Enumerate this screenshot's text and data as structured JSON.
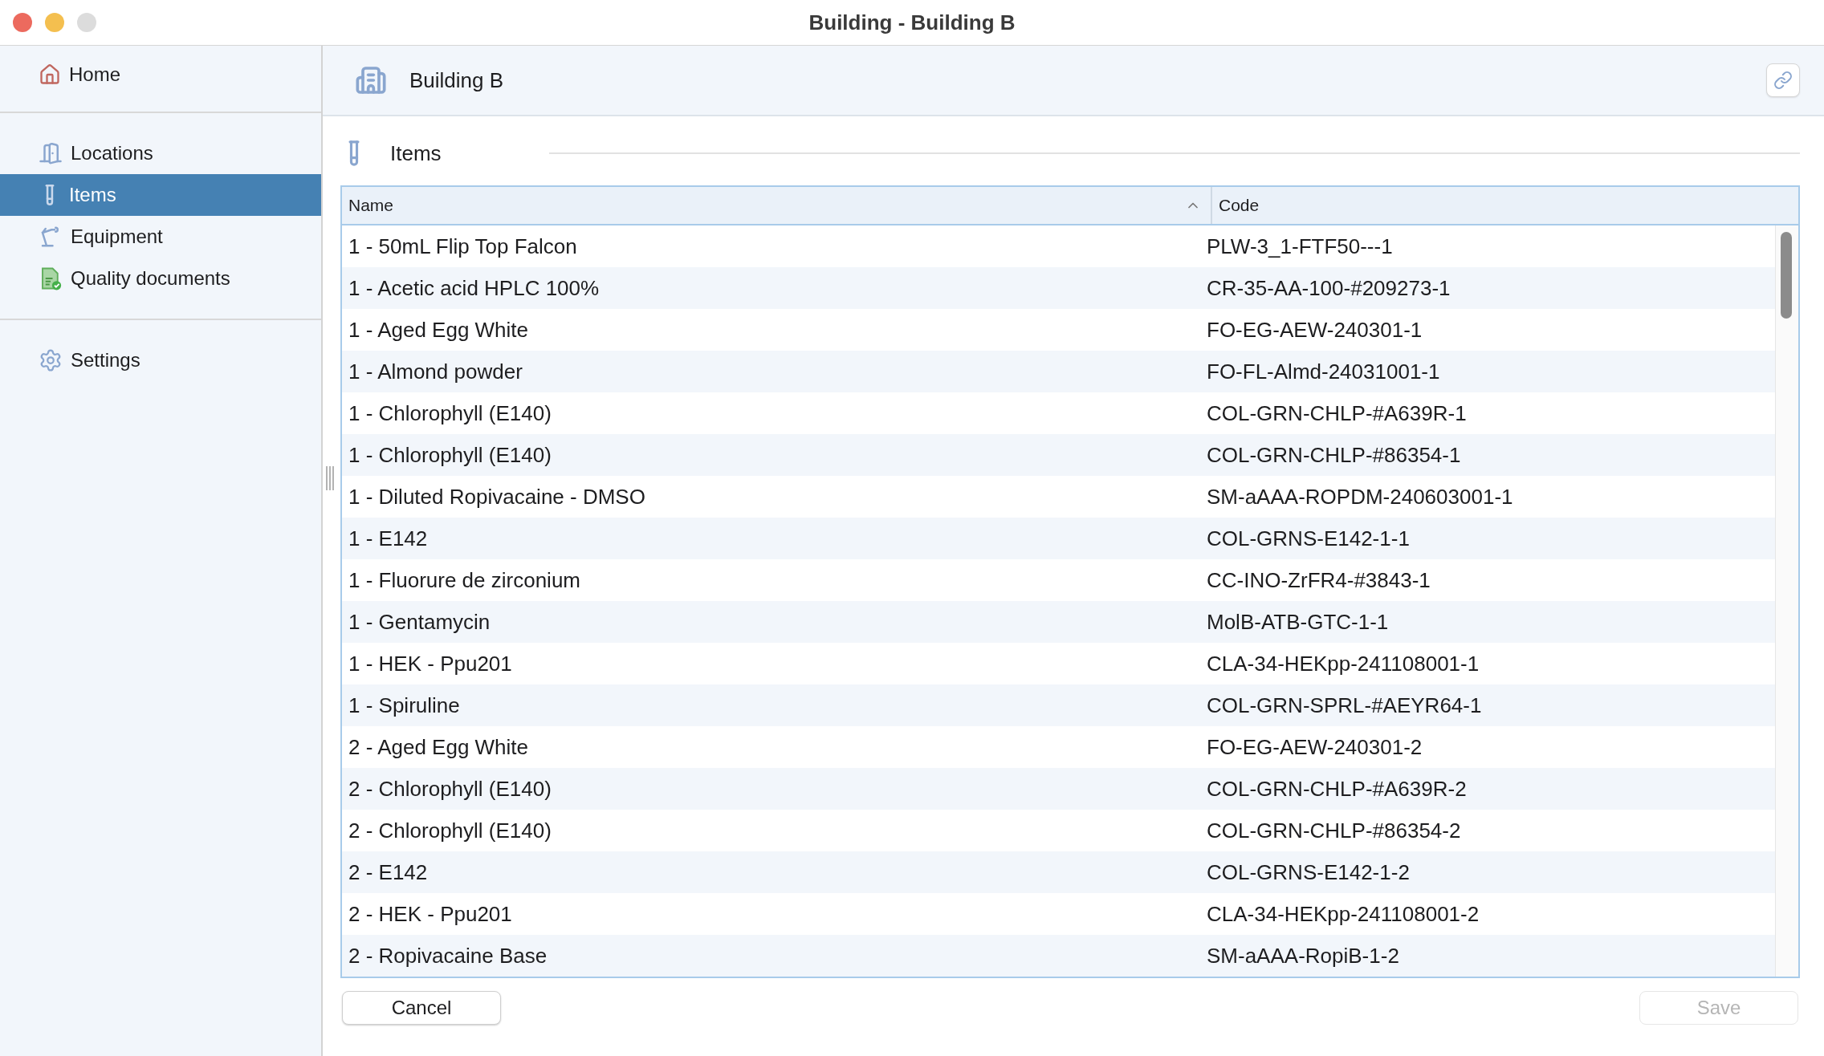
{
  "window": {
    "title": "Building - Building B"
  },
  "sidebar": {
    "sections": [
      [
        {
          "label": "Home",
          "selected": false
        }
      ],
      [
        {
          "label": "Locations",
          "selected": false
        },
        {
          "label": "Items",
          "selected": true
        },
        {
          "label": "Equipment",
          "selected": false
        },
        {
          "label": "Quality documents",
          "selected": false
        }
      ],
      [
        {
          "label": "Settings",
          "selected": false
        }
      ]
    ]
  },
  "header": {
    "title": "Building B"
  },
  "section": {
    "title": "Items"
  },
  "table": {
    "columns": [
      {
        "label": "Name",
        "sorted": true
      },
      {
        "label": "Code",
        "sorted": false
      }
    ],
    "rows": [
      [
        "1 - 50mL Flip Top Falcon",
        "PLW-3_1-FTF50---1"
      ],
      [
        "1 - Acetic acid HPLC 100%",
        "CR-35-AA-100-#209273-1"
      ],
      [
        "1 - Aged Egg White",
        "FO-EG-AEW-240301-1"
      ],
      [
        "1 - Almond powder",
        "FO-FL-Almd-24031001-1"
      ],
      [
        "1 - Chlorophyll (E140)",
        "COL-GRN-CHLP-#A639R-1"
      ],
      [
        "1 - Chlorophyll (E140)",
        "COL-GRN-CHLP-#86354-1"
      ],
      [
        "1 - Diluted Ropivacaine - DMSO",
        "SM-aAAA-ROPDM-240603001-1"
      ],
      [
        "1 - E142",
        "COL-GRNS-E142-1-1"
      ],
      [
        "1 - Fluorure de zirconium",
        "CC-INO-ZrFR4-#3843-1"
      ],
      [
        "1 - Gentamycin",
        "MolB-ATB-GTC-1-1"
      ],
      [
        "1 - HEK - Ppu201",
        "CLA-34-HEKpp-241108001-1"
      ],
      [
        "1 - Spiruline",
        "COL-GRN-SPRL-#AEYR64-1"
      ],
      [
        "2 - Aged Egg White",
        "FO-EG-AEW-240301-2"
      ],
      [
        "2 - Chlorophyll (E140)",
        "COL-GRN-CHLP-#A639R-2"
      ],
      [
        "2 - Chlorophyll (E140)",
        "COL-GRN-CHLP-#86354-2"
      ],
      [
        "2 - E142",
        "COL-GRNS-E142-1-2"
      ],
      [
        "2 - HEK - Ppu201",
        "CLA-34-HEKpp-241108001-2"
      ],
      [
        "2 - Ropivacaine  Base",
        "SM-aAAA-RopiB-1-2"
      ]
    ]
  },
  "buttons": [
    {
      "label": "Cancel",
      "disabled": false
    },
    {
      "label": "Save",
      "disabled": true
    }
  ]
}
